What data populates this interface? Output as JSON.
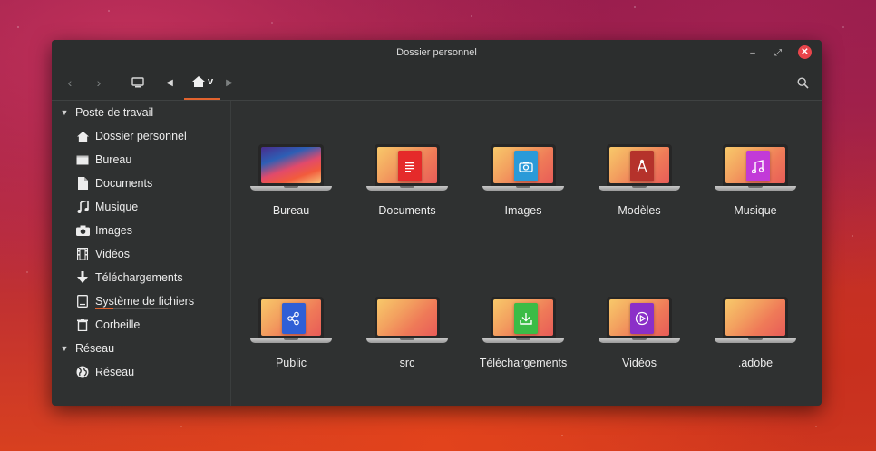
{
  "window": {
    "title": "Dossier personnel",
    "controls": {
      "minimize": "–",
      "maximize": "⤢",
      "close": "✕"
    }
  },
  "toolbar": {
    "back_icon": "‹",
    "forward_icon": "›",
    "computer_icon": "computer-icon",
    "prev_icon": "◀",
    "home_user": "v",
    "next_icon": "▶",
    "search_icon": "search-icon",
    "accent_color": "#e2632e"
  },
  "sidebar": {
    "sections": [
      {
        "label": "Poste de travail",
        "items": [
          {
            "label": "Dossier personnel",
            "icon": "home-icon"
          },
          {
            "label": "Bureau",
            "icon": "desktop-icon"
          },
          {
            "label": "Documents",
            "icon": "document-icon"
          },
          {
            "label": "Musique",
            "icon": "music-icon"
          },
          {
            "label": "Images",
            "icon": "camera-icon"
          },
          {
            "label": "Vidéos",
            "icon": "film-icon"
          },
          {
            "label": "Téléchargements",
            "icon": "download-icon"
          },
          {
            "label": "Système de fichiers",
            "icon": "drive-icon",
            "usage_fraction": 0.25
          },
          {
            "label": "Corbeille",
            "icon": "trash-icon"
          }
        ]
      },
      {
        "label": "Réseau",
        "items": [
          {
            "label": "Réseau",
            "icon": "globe-icon"
          }
        ]
      }
    ]
  },
  "files": [
    {
      "label": "Bureau",
      "badge": "",
      "badge_color": ""
    },
    {
      "label": "Documents",
      "badge": "document-icon",
      "badge_color": "#e52a2a"
    },
    {
      "label": "Images",
      "badge": "camera-icon",
      "badge_color": "#2a9ad8"
    },
    {
      "label": "Modèles",
      "badge": "template-icon",
      "badge_color": "#b5322b"
    },
    {
      "label": "Musique",
      "badge": "music-icon",
      "badge_color": "#c23ad8"
    },
    {
      "label": "Public",
      "badge": "share-icon",
      "badge_color": "#2f5fd6"
    },
    {
      "label": "src",
      "badge": "",
      "badge_color": ""
    },
    {
      "label": "Téléchargements",
      "badge": "download-icon",
      "badge_color": "#3cbc46"
    },
    {
      "label": "Vidéos",
      "badge": "video-icon",
      "badge_color": "#8b2fc8"
    },
    {
      "label": ".adobe",
      "badge": "",
      "badge_color": ""
    }
  ]
}
